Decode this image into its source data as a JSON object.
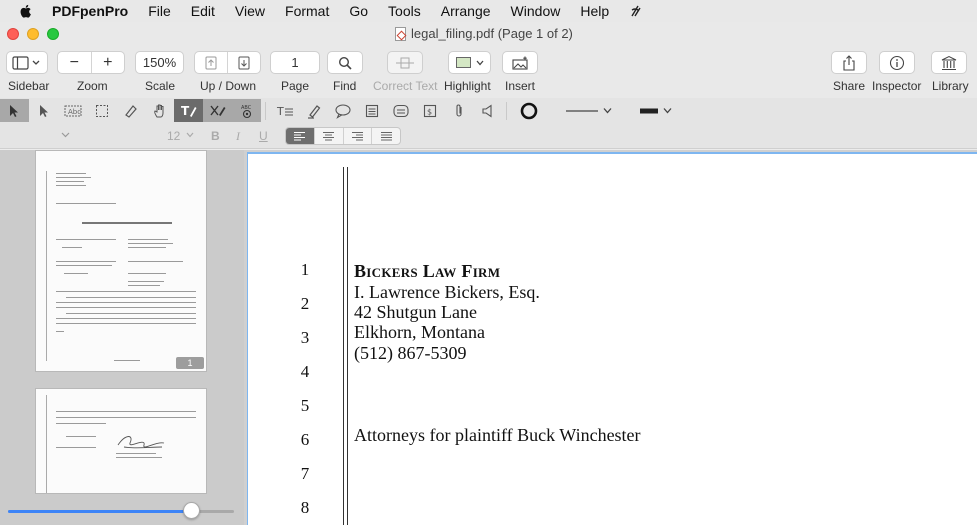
{
  "menubar": {
    "app_name": "PDFpenPro",
    "items": [
      "File",
      "Edit",
      "View",
      "Format",
      "Go",
      "Tools",
      "Arrange",
      "Window",
      "Help"
    ]
  },
  "window": {
    "title": "legal_filing.pdf (Page 1 of 2)"
  },
  "toolbar": {
    "sidebar_label": "Sidebar",
    "zoom_label": "Zoom",
    "zoom_out": "−",
    "zoom_in": "+",
    "scale_value": "150%",
    "scale_label": "Scale",
    "updown_label": "Up / Down",
    "page_value": "1",
    "page_label": "Page",
    "find_label": "Find",
    "correct_text_label": "Correct Text",
    "highlight_label": "Highlight",
    "insert_label": "Insert",
    "share_label": "Share",
    "inspector_label": "Inspector",
    "library_label": "Library"
  },
  "format": {
    "font_size": "12",
    "bold": "B",
    "italic": "I",
    "underline": "U"
  },
  "sidebar": {
    "page1_badge": "1",
    "thumbnail_zoom_percent": 81
  },
  "document": {
    "line_numbers": [
      "1",
      "2",
      "3",
      "4",
      "5",
      "6",
      "7",
      "8"
    ],
    "firm_name": "Bickers Law Firm",
    "attorney": "I. Lawrence Bickers, Esq.",
    "street": "42 Shutgun Lane",
    "city": "Elkhorn, Montana",
    "phone": "(512) 867-5309",
    "attorneys_for": "Attorneys for plaintiff Buck Winchester"
  },
  "colors": {
    "accent": "#3d84f7",
    "active_tool": "#6b6b6b",
    "page_selection": "#7eb6f0"
  }
}
